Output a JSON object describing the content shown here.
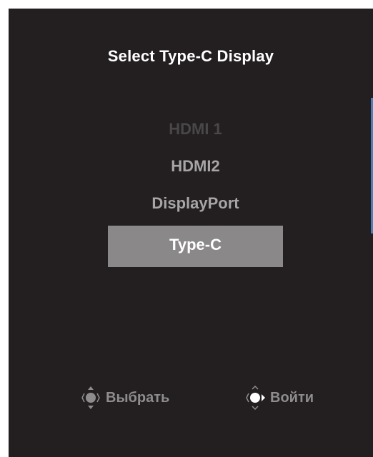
{
  "menu": {
    "title": "Select Type-C Display",
    "options": [
      {
        "label": "HDMI 1",
        "state": "disabled"
      },
      {
        "label": "HDMI2",
        "state": "available"
      },
      {
        "label": "DisplayPort",
        "state": "available"
      },
      {
        "label": "Type-C",
        "state": "selected"
      }
    ]
  },
  "hints": {
    "select": {
      "icon": "joystick-up-down-icon",
      "label": "Выбрать"
    },
    "enter": {
      "icon": "joystick-right-icon",
      "label": "Войти"
    }
  },
  "colors": {
    "panel_bg": "#231f20",
    "selected_bg": "#8a8888",
    "scroll_accent": "#4a7fb8"
  }
}
